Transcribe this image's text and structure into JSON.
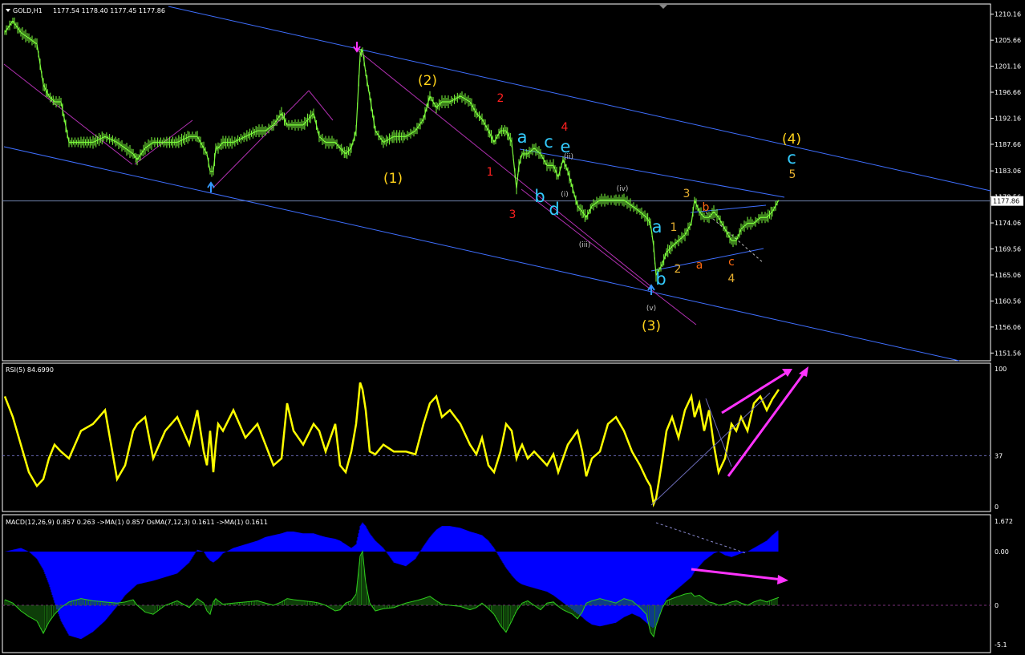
{
  "window": {
    "title": "GOLD,H1",
    "ohlc": "1177.54 1178.40 1177.45 1177.86"
  },
  "colors": {
    "background": "#000000",
    "grid_border": "#ffffff",
    "price": "#7cfc3c",
    "channel": "#3f6fff",
    "trend": "#b030b0",
    "rsi": "#ffff00",
    "macd_hist": "#0000ff",
    "osma": "#2ecc1c",
    "annotation_arrow": "#ff33ff",
    "wave_yellow": "#ffd21a",
    "wave_red": "#ff2020",
    "wave_cyan": "#33ccff",
    "wave_orange": "#ff6a10",
    "wave_gray": "#c0c0c0",
    "wave_small_yellow": "#e8b030"
  },
  "price_panel": {
    "current_price": "1177.86",
    "price_axis_labels": [
      "1210.16",
      "1205.66",
      "1201.16",
      "1196.66",
      "1192.16",
      "1187.66",
      "1183.06",
      "1178.56",
      "1174.06",
      "1169.56",
      "1165.06",
      "1160.56",
      "1156.06",
      "1151.56"
    ],
    "wave_labels": [
      {
        "text": "(1)",
        "color": "wave_yellow",
        "size": "large"
      },
      {
        "text": "(2)",
        "color": "wave_yellow",
        "size": "large"
      },
      {
        "text": "(3)",
        "color": "wave_yellow",
        "size": "large"
      },
      {
        "text": "(4)",
        "color": "wave_yellow",
        "size": "large"
      },
      {
        "text": "1",
        "color": "wave_red",
        "size": "medium"
      },
      {
        "text": "2",
        "color": "wave_red",
        "size": "medium"
      },
      {
        "text": "3",
        "color": "wave_red",
        "size": "medium"
      },
      {
        "text": "4",
        "color": "wave_red",
        "size": "medium"
      },
      {
        "text": "a",
        "color": "wave_cyan",
        "size": "xlarge"
      },
      {
        "text": "b",
        "color": "wave_cyan",
        "size": "xlarge"
      },
      {
        "text": "c",
        "color": "wave_cyan",
        "size": "xlarge"
      },
      {
        "text": "d",
        "color": "wave_cyan",
        "size": "xlarge"
      },
      {
        "text": "e",
        "color": "wave_cyan",
        "size": "xlarge"
      },
      {
        "text": "a",
        "color": "wave_cyan",
        "size": "xlarge"
      },
      {
        "text": "b",
        "color": "wave_cyan",
        "size": "xlarge"
      },
      {
        "text": "c",
        "color": "wave_cyan",
        "size": "xlarge"
      },
      {
        "text": "(i)",
        "color": "wave_gray",
        "size": "small"
      },
      {
        "text": "(ii)",
        "color": "wave_gray",
        "size": "small"
      },
      {
        "text": "(iii)",
        "color": "wave_gray",
        "size": "small"
      },
      {
        "text": "(iv)",
        "color": "wave_gray",
        "size": "small"
      },
      {
        "text": "(v)",
        "color": "wave_gray",
        "size": "small"
      },
      {
        "text": "1",
        "color": "wave_small_yellow",
        "size": "medium"
      },
      {
        "text": "2",
        "color": "wave_small_yellow",
        "size": "medium"
      },
      {
        "text": "3",
        "color": "wave_small_yellow",
        "size": "medium"
      },
      {
        "text": "4",
        "color": "wave_small_yellow",
        "size": "medium"
      },
      {
        "text": "5",
        "color": "wave_small_yellow",
        "size": "medium"
      },
      {
        "text": "a",
        "color": "wave_orange",
        "size": "medium"
      },
      {
        "text": "b",
        "color": "wave_orange",
        "size": "medium"
      },
      {
        "text": "c",
        "color": "wave_orange",
        "size": "medium"
      }
    ]
  },
  "rsi_panel": {
    "header": "RSI(5) 84.6990",
    "axis_labels": [
      "100",
      "37",
      "0"
    ],
    "level": 37
  },
  "macd_panel": {
    "header": "MACD(12,26,9) 0.857 0.263  ->MA(1) 0.857  OsMA(7,12,3) 0.1611  ->MA(1) 0.1611",
    "axis_labels": [
      "1.672",
      "0.00",
      "0",
      "-5.1"
    ]
  },
  "chart_data": [
    {
      "type": "line",
      "title": "GOLD,H1",
      "ylim": [
        1150.5,
        1211.5
      ],
      "x": [
        0,
        10,
        20,
        30,
        40,
        48,
        55,
        62,
        70,
        80,
        95,
        110,
        125,
        140,
        150,
        160,
        165,
        175,
        185,
        200,
        215,
        230,
        240,
        248,
        252,
        256,
        260,
        263,
        266,
        272,
        285,
        300,
        315,
        325,
        335,
        345,
        352,
        360,
        372,
        385,
        392,
        400,
        412,
        418,
        425,
        432,
        438,
        443,
        446,
        450,
        455,
        462,
        472,
        485,
        500,
        512,
        522,
        530,
        538,
        545,
        555,
        568,
        580,
        588,
        595,
        603,
        610,
        618,
        625,
        632,
        638,
        641,
        645,
        652,
        660,
        668,
        676,
        684,
        690,
        696,
        702,
        708,
        714,
        720,
        725,
        732,
        742,
        752,
        762,
        772,
        782,
        792,
        800,
        805,
        809,
        812,
        816,
        820,
        825,
        832,
        840,
        848,
        856,
        860,
        866,
        872,
        878,
        884,
        890,
        898,
        906,
        912,
        918,
        926,
        934,
        942,
        950,
        957,
        965
      ],
      "series": [
        {
          "values": [
            1207,
            1209,
            1207,
            1206,
            1205,
            1198,
            1196,
            1195,
            1195,
            1188,
            1188,
            1188,
            1189,
            1188,
            1187,
            1186,
            1185,
            1187,
            1188,
            1188,
            1188,
            1189,
            1189,
            1187,
            1186,
            1183,
            1183,
            1187,
            1187,
            1188,
            1188,
            1189,
            1190,
            1190,
            1191,
            1193,
            1191,
            1191,
            1191,
            1193,
            1189,
            1188,
            1188,
            1187,
            1186,
            1187,
            1190,
            1203,
            1204,
            1200,
            1196,
            1190,
            1188,
            1189,
            1189,
            1190,
            1192,
            1196,
            1194,
            1195,
            1195,
            1196,
            1195,
            1193,
            1192,
            1190,
            1188,
            1190,
            1190,
            1188,
            1180,
            1184,
            1186,
            1186,
            1187,
            1186,
            1184,
            1184,
            1182,
            1185,
            1183,
            1180,
            1177,
            1176,
            1175,
            1177,
            1178,
            1178,
            1178,
            1178,
            1177,
            1176,
            1175,
            1174,
            1170,
            1165,
            1166,
            1167,
            1169,
            1170,
            1171,
            1172,
            1174,
            1178,
            1176,
            1175,
            1175,
            1176,
            1175,
            1173,
            1171,
            1171,
            1173,
            1174,
            1174,
            1175,
            1175,
            1176,
            1178
          ]
        }
      ]
    },
    {
      "type": "line",
      "title": "RSI(5) 84.6990",
      "ylim": [
        0,
        100
      ],
      "x": [
        0,
        10,
        20,
        30,
        40,
        48,
        55,
        62,
        70,
        80,
        95,
        110,
        125,
        140,
        150,
        160,
        165,
        175,
        185,
        200,
        215,
        230,
        240,
        248,
        252,
        256,
        260,
        263,
        266,
        272,
        285,
        300,
        315,
        325,
        335,
        345,
        352,
        360,
        372,
        385,
        392,
        400,
        412,
        418,
        425,
        432,
        438,
        443,
        446,
        450,
        455,
        462,
        472,
        485,
        500,
        512,
        522,
        530,
        538,
        545,
        555,
        568,
        580,
        588,
        595,
        603,
        610,
        618,
        625,
        632,
        638,
        641,
        645,
        652,
        660,
        668,
        676,
        684,
        690,
        696,
        702,
        708,
        714,
        720,
        725,
        732,
        742,
        752,
        762,
        772,
        782,
        792,
        800,
        805,
        809,
        812,
        816,
        820,
        825,
        832,
        840,
        848,
        856,
        860,
        866,
        872,
        878,
        884,
        890,
        898,
        906,
        912,
        918,
        926,
        934,
        942,
        950,
        957,
        965
      ],
      "series": [
        {
          "values": [
            80,
            65,
            45,
            25,
            15,
            20,
            35,
            45,
            40,
            35,
            55,
            60,
            70,
            20,
            30,
            55,
            60,
            65,
            35,
            55,
            65,
            45,
            70,
            40,
            30,
            55,
            25,
            45,
            60,
            55,
            70,
            50,
            60,
            45,
            30,
            35,
            75,
            55,
            45,
            60,
            55,
            40,
            60,
            30,
            25,
            40,
            60,
            90,
            85,
            70,
            40,
            38,
            45,
            40,
            40,
            38,
            60,
            75,
            80,
            65,
            70,
            60,
            45,
            38,
            50,
            30,
            25,
            40,
            60,
            55,
            35,
            40,
            45,
            35,
            40,
            35,
            30,
            38,
            25,
            35,
            45,
            50,
            55,
            40,
            22,
            35,
            40,
            60,
            65,
            55,
            40,
            30,
            20,
            15,
            2,
            6,
            20,
            35,
            55,
            65,
            50,
            70,
            80,
            65,
            75,
            55,
            70,
            45,
            25,
            35,
            60,
            55,
            65,
            55,
            75,
            80,
            70,
            78,
            85
          ]
        }
      ],
      "reference_line": 37
    },
    {
      "type": "bar",
      "title": "MACD(12,26,9) 0.857 0.263",
      "ylim": [
        -5.1,
        1.672
      ],
      "x": [
        0,
        10,
        20,
        30,
        40,
        48,
        55,
        62,
        70,
        80,
        95,
        110,
        125,
        140,
        150,
        160,
        165,
        175,
        185,
        200,
        215,
        230,
        240,
        248,
        252,
        256,
        260,
        263,
        266,
        272,
        285,
        300,
        315,
        325,
        335,
        345,
        352,
        360,
        372,
        385,
        392,
        400,
        412,
        418,
        425,
        432,
        438,
        443,
        446,
        450,
        455,
        462,
        472,
        485,
        500,
        512,
        522,
        530,
        538,
        545,
        555,
        568,
        580,
        588,
        595,
        603,
        610,
        618,
        625,
        632,
        638,
        641,
        645,
        652,
        660,
        668,
        676,
        684,
        690,
        696,
        702,
        708,
        714,
        720,
        725,
        732,
        742,
        752,
        762,
        772,
        782,
        792,
        800,
        805,
        809,
        812,
        816,
        820,
        825,
        832,
        840,
        848,
        856,
        860,
        866,
        872,
        878,
        884,
        890,
        898,
        906,
        912,
        918,
        926,
        934,
        942,
        950,
        957,
        965
      ],
      "series": [
        {
          "name": "MACD",
          "values": [
            0,
            0.1,
            0.2,
            0,
            -0.4,
            -1.0,
            -1.8,
            -2.8,
            -3.8,
            -4.6,
            -4.8,
            -4.4,
            -3.8,
            -3.0,
            -2.4,
            -2.0,
            -1.8,
            -1.7,
            -1.6,
            -1.4,
            -1.2,
            -0.6,
            0.1,
            0.0,
            -0.3,
            -0.5,
            -0.6,
            -0.5,
            -0.4,
            -0.1,
            0.2,
            0.4,
            0.6,
            0.8,
            0.9,
            1.0,
            1.1,
            1.1,
            1.0,
            1.0,
            0.9,
            0.8,
            0.7,
            0.6,
            0.4,
            0.2,
            0.4,
            1.4,
            1.6,
            1.4,
            1.0,
            0.6,
            0.2,
            -0.6,
            -0.8,
            -0.4,
            0.3,
            0.8,
            1.2,
            1.4,
            1.4,
            1.3,
            1.1,
            1.0,
            0.9,
            0.6,
            0.2,
            -0.4,
            -0.9,
            -1.3,
            -1.6,
            -1.7,
            -1.8,
            -1.9,
            -2.0,
            -2.1,
            -2.2,
            -2.4,
            -2.6,
            -2.8,
            -3.0,
            -3.2,
            -3.4,
            -3.6,
            -3.8,
            -4.0,
            -4.1,
            -4.0,
            -3.9,
            -3.6,
            -3.4,
            -3.6,
            -3.9,
            -4.1,
            -4.2,
            -4.0,
            -3.6,
            -3.0,
            -2.6,
            -2.3,
            -2.0,
            -1.7,
            -1.4,
            -1.1,
            -0.8,
            -0.5,
            -0.3,
            -0.1,
            0.0,
            -0.2,
            -0.3,
            -0.2,
            -0.1,
            0.0,
            0.2,
            0.4,
            0.6,
            0.9,
            1.2
          ]
        },
        {
          "name": "OsMA",
          "values": [
            0.5,
            0.2,
            -0.5,
            -1.0,
            -1.4,
            -2.5,
            -1.5,
            -0.8,
            -0.2,
            0.3,
            0.6,
            0.4,
            0.3,
            0.2,
            0.3,
            0.5,
            0.0,
            -0.6,
            -0.8,
            0.0,
            0.4,
            -0.2,
            0.6,
            0.2,
            -0.5,
            -0.8,
            0.3,
            0.6,
            0.4,
            0.1,
            0.2,
            0.3,
            0.4,
            0.2,
            0.0,
            0.3,
            0.6,
            0.5,
            0.4,
            0.3,
            0.2,
            0.0,
            -0.5,
            -0.4,
            0.2,
            0.4,
            1.0,
            4.4,
            4.8,
            2.0,
            0.2,
            -0.5,
            -0.3,
            -0.2,
            0.2,
            0.4,
            0.6,
            0.8,
            0.4,
            0.1,
            0.0,
            -0.1,
            -0.4,
            -0.2,
            0.2,
            -0.3,
            -0.8,
            -1.8,
            -2.4,
            -1.4,
            -0.5,
            -0.2,
            0.2,
            0.4,
            0.0,
            -0.4,
            0.2,
            0.3,
            -0.1,
            -0.4,
            -0.6,
            -0.8,
            -1.2,
            -0.6,
            0.2,
            0.4,
            0.6,
            0.4,
            0.2,
            0.6,
            0.4,
            -0.2,
            -0.8,
            -2.4,
            -2.8,
            -1.8,
            -1.0,
            -0.2,
            0.4,
            0.6,
            0.8,
            1.0,
            1.1,
            0.8,
            0.9,
            0.6,
            0.3,
            0.2,
            0.0,
            0.1,
            0.3,
            0.4,
            0.2,
            0.0,
            0.3,
            0.5,
            0.3,
            0.5,
            0.7
          ]
        }
      ]
    }
  ]
}
